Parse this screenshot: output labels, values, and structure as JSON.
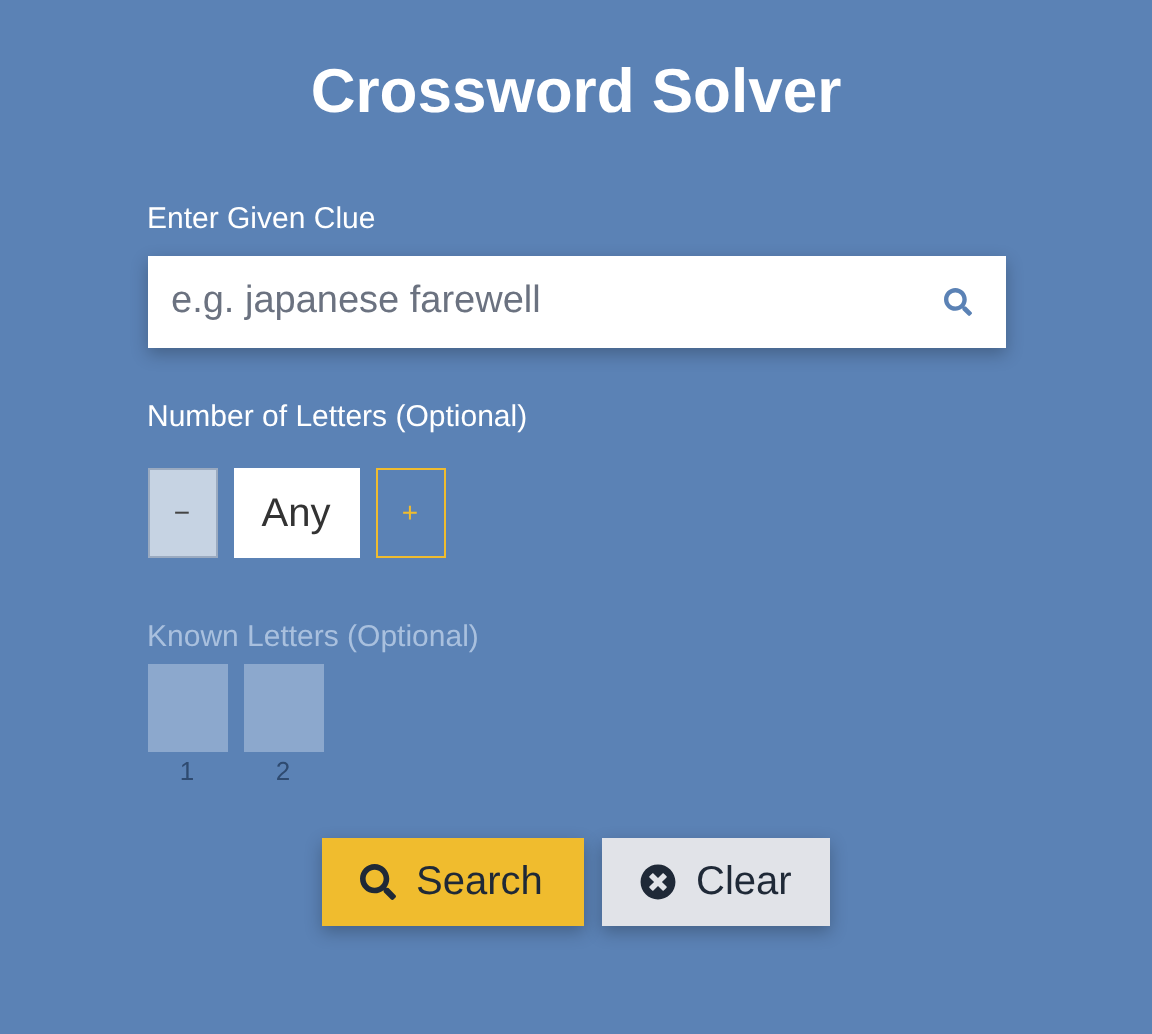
{
  "title": "Crossword Solver",
  "clue": {
    "label": "Enter Given Clue",
    "placeholder": "e.g. japanese farewell"
  },
  "length": {
    "label": "Number of Letters (Optional)",
    "minus": "−",
    "value": "Any",
    "plus": "+",
    "minus_disabled": true
  },
  "known_letters": {
    "label": "Known Letters (Optional)",
    "disabled": true,
    "slots": [
      {
        "number": "1"
      },
      {
        "number": "2"
      }
    ]
  },
  "buttons": [
    {
      "kind": "search",
      "label": "Search"
    },
    {
      "kind": "clear",
      "label": "Clear"
    }
  ]
}
